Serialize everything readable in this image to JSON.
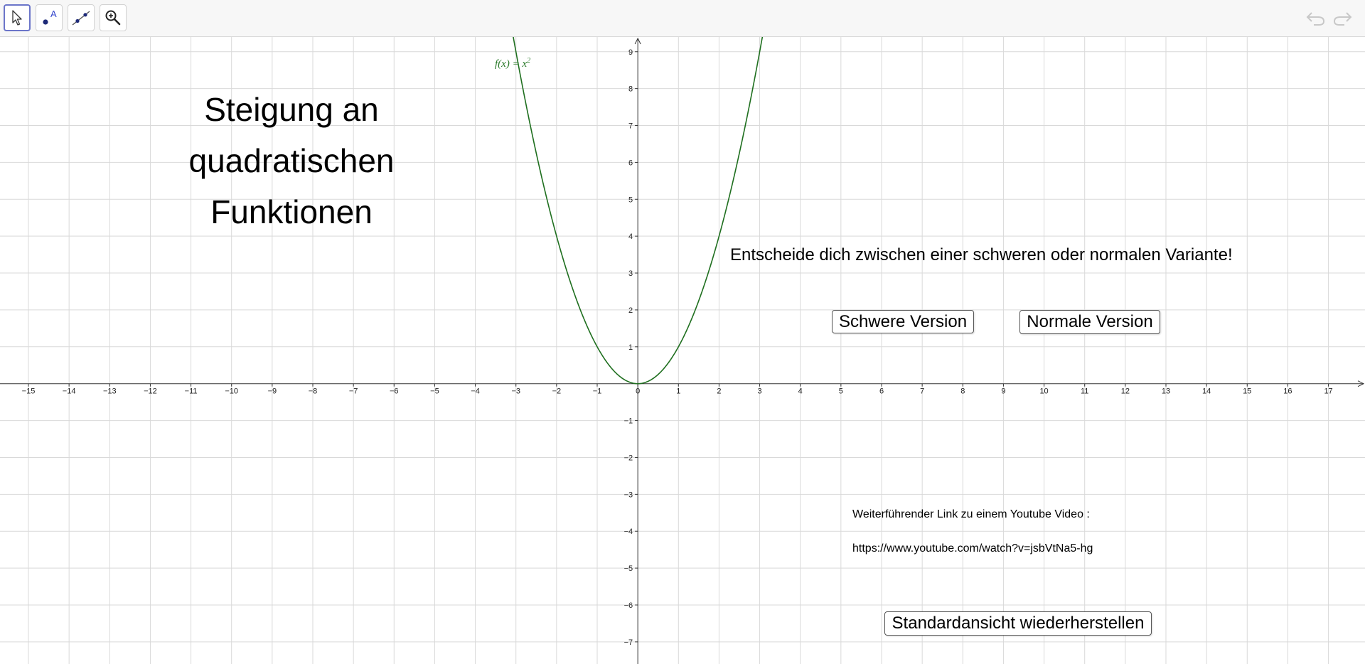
{
  "toolbar": {
    "tools": [
      {
        "icon": "pointer-arrow-icon",
        "active": true
      },
      {
        "icon": "point-tool-icon",
        "letter": "A"
      },
      {
        "icon": "line-tool-icon"
      },
      {
        "icon": "zoom-in-icon"
      }
    ],
    "undo_icon": "undo-arrow-icon",
    "redo_icon": "redo-arrow-icon"
  },
  "canvas": {
    "title_lines": [
      "Steigung an",
      "quadratischen",
      "Funktionen"
    ],
    "prompt": "Entscheide dich zwischen einer schweren oder normalen Variante!",
    "buttons": {
      "hard": "Schwere Version",
      "normal": "Normale Version",
      "reset": "Standardansicht wiederherstellen"
    },
    "link_label": "Weiterführender Link zu einem Youtube Video :",
    "link_url": "https://www.youtube.com/watch?v=jsbVtNa5-hg",
    "function_label": {
      "name": "f(x) = x",
      "exponent": "2"
    }
  },
  "chart_data": {
    "type": "line",
    "title": "",
    "xlabel": "",
    "ylabel": "",
    "xlim": [
      -15.7,
      17.9
    ],
    "ylim": [
      -7.6,
      9.4
    ],
    "grid": true,
    "x_ticks": [
      -15,
      -14,
      -13,
      -12,
      -11,
      -10,
      -9,
      -8,
      -7,
      -6,
      -5,
      -4,
      -3,
      -2,
      -1,
      0,
      1,
      2,
      3,
      4,
      5,
      6,
      7,
      8,
      9,
      10,
      11,
      12,
      13,
      14,
      15,
      16,
      17
    ],
    "y_ticks": [
      -7,
      -6,
      -5,
      -4,
      -3,
      -2,
      -1,
      1,
      2,
      3,
      4,
      5,
      6,
      7,
      8,
      9
    ],
    "series": [
      {
        "name": "f(x) = x^2",
        "color": "#1f6f1f",
        "x": [
          -3.15,
          -3,
          -2.5,
          -2,
          -1.5,
          -1,
          -0.5,
          0,
          0.5,
          1,
          1.5,
          2,
          2.5,
          3,
          3.15
        ],
        "y": [
          9.92,
          9,
          6.25,
          4,
          2.25,
          1,
          0.25,
          0,
          0.25,
          1,
          2.25,
          4,
          6.25,
          9,
          9.92
        ]
      }
    ]
  }
}
